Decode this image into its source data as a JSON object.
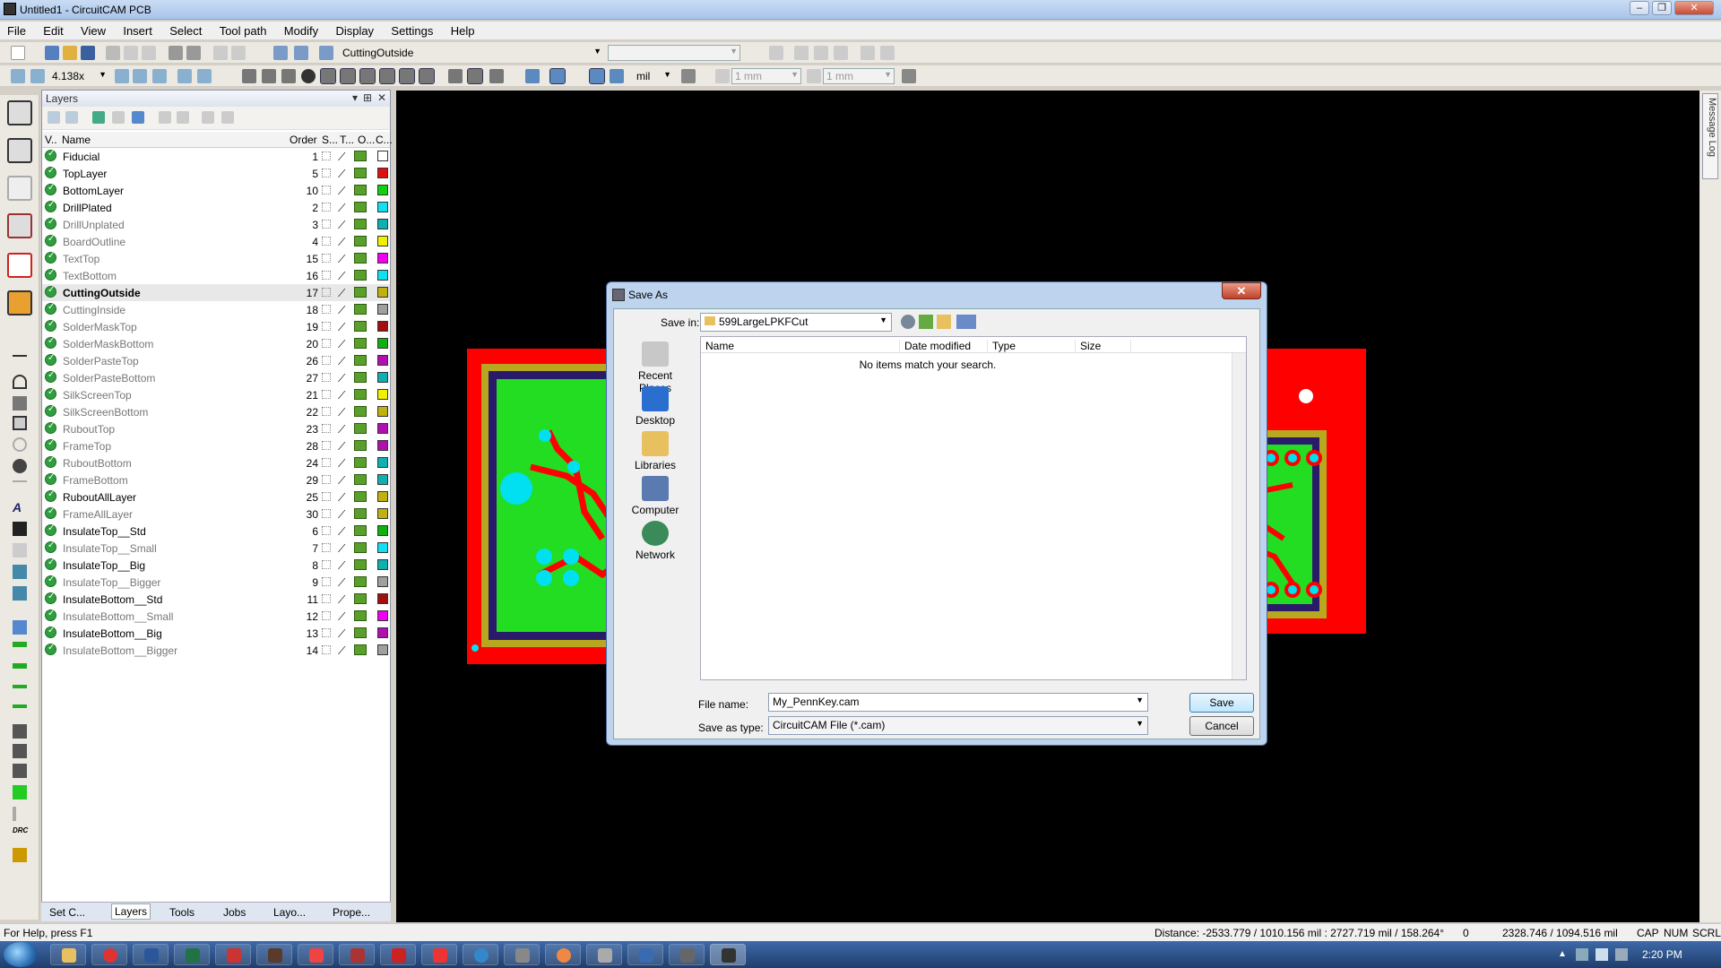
{
  "window": {
    "title": "Untitled1 - CircuitCAM PCB"
  },
  "menu": [
    "File",
    "Edit",
    "View",
    "Insert",
    "Select",
    "Tool path",
    "Modify",
    "Display",
    "Settings",
    "Help"
  ],
  "toolbar1": {
    "layer_combo": "CuttingOutside"
  },
  "toolbar2": {
    "zoom": "4.138x",
    "unit": "mil",
    "grid1": "1 mm",
    "grid2": "1 mm"
  },
  "layers_panel": {
    "title": "Layers",
    "columns": {
      "v": "V..",
      "name": "Name",
      "order": "Order",
      "s": "S...",
      "t": "T...",
      "o": "O...",
      "c": "C..."
    },
    "rows": [
      {
        "name": "Fiducial",
        "order": "1",
        "color": "#ffffff",
        "bold": true
      },
      {
        "name": "TopLayer",
        "order": "5",
        "color": "#e01010",
        "bold": true
      },
      {
        "name": "BottomLayer",
        "order": "10",
        "color": "#10d010",
        "bold": true
      },
      {
        "name": "DrillPlated",
        "order": "2",
        "color": "#10e0f0",
        "bold": true
      },
      {
        "name": "DrillUnplated",
        "order": "3",
        "color": "#10b0b0",
        "bold": false
      },
      {
        "name": "BoardOutline",
        "order": "4",
        "color": "#f0f000",
        "bold": false
      },
      {
        "name": "TextTop",
        "order": "15",
        "color": "#f000f0",
        "bold": false
      },
      {
        "name": "TextBottom",
        "order": "16",
        "color": "#10e0f0",
        "bold": false
      },
      {
        "name": "CuttingOutside",
        "order": "17",
        "color": "#c0b010",
        "bold": true
      },
      {
        "name": "CuttingInside",
        "order": "18",
        "color": "#a0a0a0",
        "bold": false
      },
      {
        "name": "SolderMaskTop",
        "order": "19",
        "color": "#a01010",
        "bold": false
      },
      {
        "name": "SolderMaskBottom",
        "order": "20",
        "color": "#10b010",
        "bold": false
      },
      {
        "name": "SolderPasteTop",
        "order": "26",
        "color": "#b010b0",
        "bold": false
      },
      {
        "name": "SolderPasteBottom",
        "order": "27",
        "color": "#10b0b0",
        "bold": false
      },
      {
        "name": "SilkScreenTop",
        "order": "21",
        "color": "#f0f000",
        "bold": false
      },
      {
        "name": "SilkScreenBottom",
        "order": "22",
        "color": "#c0b010",
        "bold": false
      },
      {
        "name": "RuboutTop",
        "order": "23",
        "color": "#b010b0",
        "bold": false
      },
      {
        "name": "FrameTop",
        "order": "28",
        "color": "#b010b0",
        "bold": false
      },
      {
        "name": "RuboutBottom",
        "order": "24",
        "color": "#10b0b0",
        "bold": false
      },
      {
        "name": "FrameBottom",
        "order": "29",
        "color": "#10b0b0",
        "bold": false
      },
      {
        "name": "RuboutAllLayer",
        "order": "25",
        "color": "#c0b010",
        "bold": true
      },
      {
        "name": "FrameAllLayer",
        "order": "30",
        "color": "#c0b010",
        "bold": false
      },
      {
        "name": "InsulateTop__Std",
        "order": "6",
        "color": "#10b010",
        "bold": true
      },
      {
        "name": "InsulateTop__Small",
        "order": "7",
        "color": "#10e0f0",
        "bold": false
      },
      {
        "name": "InsulateTop__Big",
        "order": "8",
        "color": "#10b0b0",
        "bold": true
      },
      {
        "name": "InsulateTop__Bigger",
        "order": "9",
        "color": "#a0a0a0",
        "bold": false
      },
      {
        "name": "InsulateBottom__Std",
        "order": "11",
        "color": "#a01010",
        "bold": true
      },
      {
        "name": "InsulateBottom__Small",
        "order": "12",
        "color": "#f000f0",
        "bold": false
      },
      {
        "name": "InsulateBottom__Big",
        "order": "13",
        "color": "#b010b0",
        "bold": true
      },
      {
        "name": "InsulateBottom__Bigger",
        "order": "14",
        "color": "#a0a0a0",
        "bold": false
      }
    ],
    "selected": "CuttingOutside"
  },
  "bottom_tabs": [
    "Set C...",
    "Layers",
    "Tools",
    "Jobs",
    "Layo...",
    "Prope..."
  ],
  "message_log": "Message Log",
  "dialog": {
    "title": "Save As",
    "save_in_label": "Save in:",
    "save_in_value": "599LargeLPKFCut",
    "places": [
      "Recent Places",
      "Desktop",
      "Libraries",
      "Computer",
      "Network"
    ],
    "columns": [
      "Name",
      "Date modified",
      "Type",
      "Size"
    ],
    "empty_text": "No items match your search.",
    "file_name_label": "File name:",
    "file_name_value": "My_PennKey.cam",
    "save_type_label": "Save as type:",
    "save_type_value": "CircuitCAM File (*.cam)",
    "save_button": "Save",
    "cancel_button": "Cancel"
  },
  "status": {
    "help": "For Help, press F1",
    "distance": "Distance: -2533.779 / 1010.156 mil : 2727.719 mil / 158.264°",
    "zero": "0",
    "coords": "2328.746 / 1094.516 mil",
    "cap": "CAP",
    "num": "NUM",
    "scrl": "SCRL"
  },
  "taskbar": {
    "clock": "2:20 PM"
  },
  "colors": {
    "pcb_red": "#ff0000",
    "pcb_green": "#22dd22",
    "pad_cyan": "#00e0f0",
    "canvas": "#000000"
  }
}
